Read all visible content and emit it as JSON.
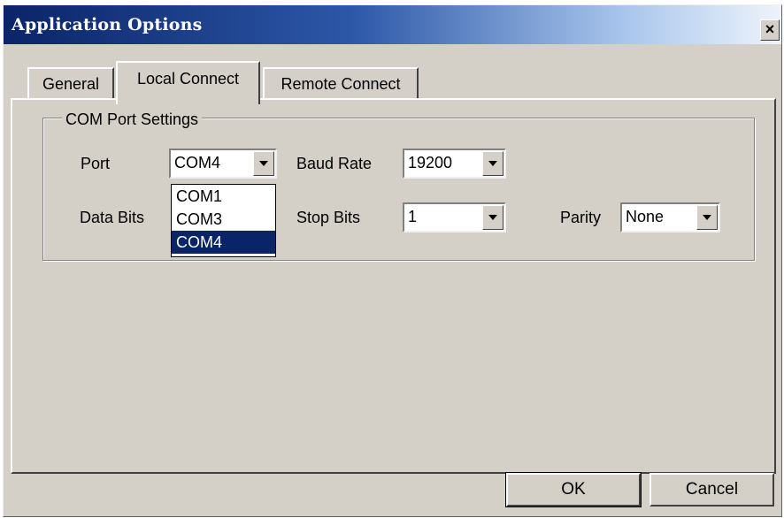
{
  "window": {
    "title": "Application Options",
    "close_glyph": "×"
  },
  "tabs": [
    {
      "label": "General",
      "active": false
    },
    {
      "label": "Local Connect",
      "active": true
    },
    {
      "label": "Remote Connect",
      "active": false
    }
  ],
  "com_settings": {
    "group_title": "COM Port Settings",
    "port": {
      "label": "Port",
      "value": "COM4",
      "options": [
        "COM1",
        "COM3",
        "COM4"
      ],
      "selected_index": 2,
      "dropdown_open": true
    },
    "baud_rate": {
      "label": "Baud Rate",
      "value": "19200"
    },
    "data_bits": {
      "label": "Data Bits",
      "value": ""
    },
    "stop_bits": {
      "label": "Stop Bits",
      "value": "1"
    },
    "parity": {
      "label": "Parity",
      "value": "None"
    }
  },
  "buttons": {
    "ok": "OK",
    "cancel": "Cancel"
  },
  "colors": {
    "selection_highlight": "#0a246a",
    "title_gradient_start": "#0a2468",
    "face": "#d4d0c8"
  }
}
